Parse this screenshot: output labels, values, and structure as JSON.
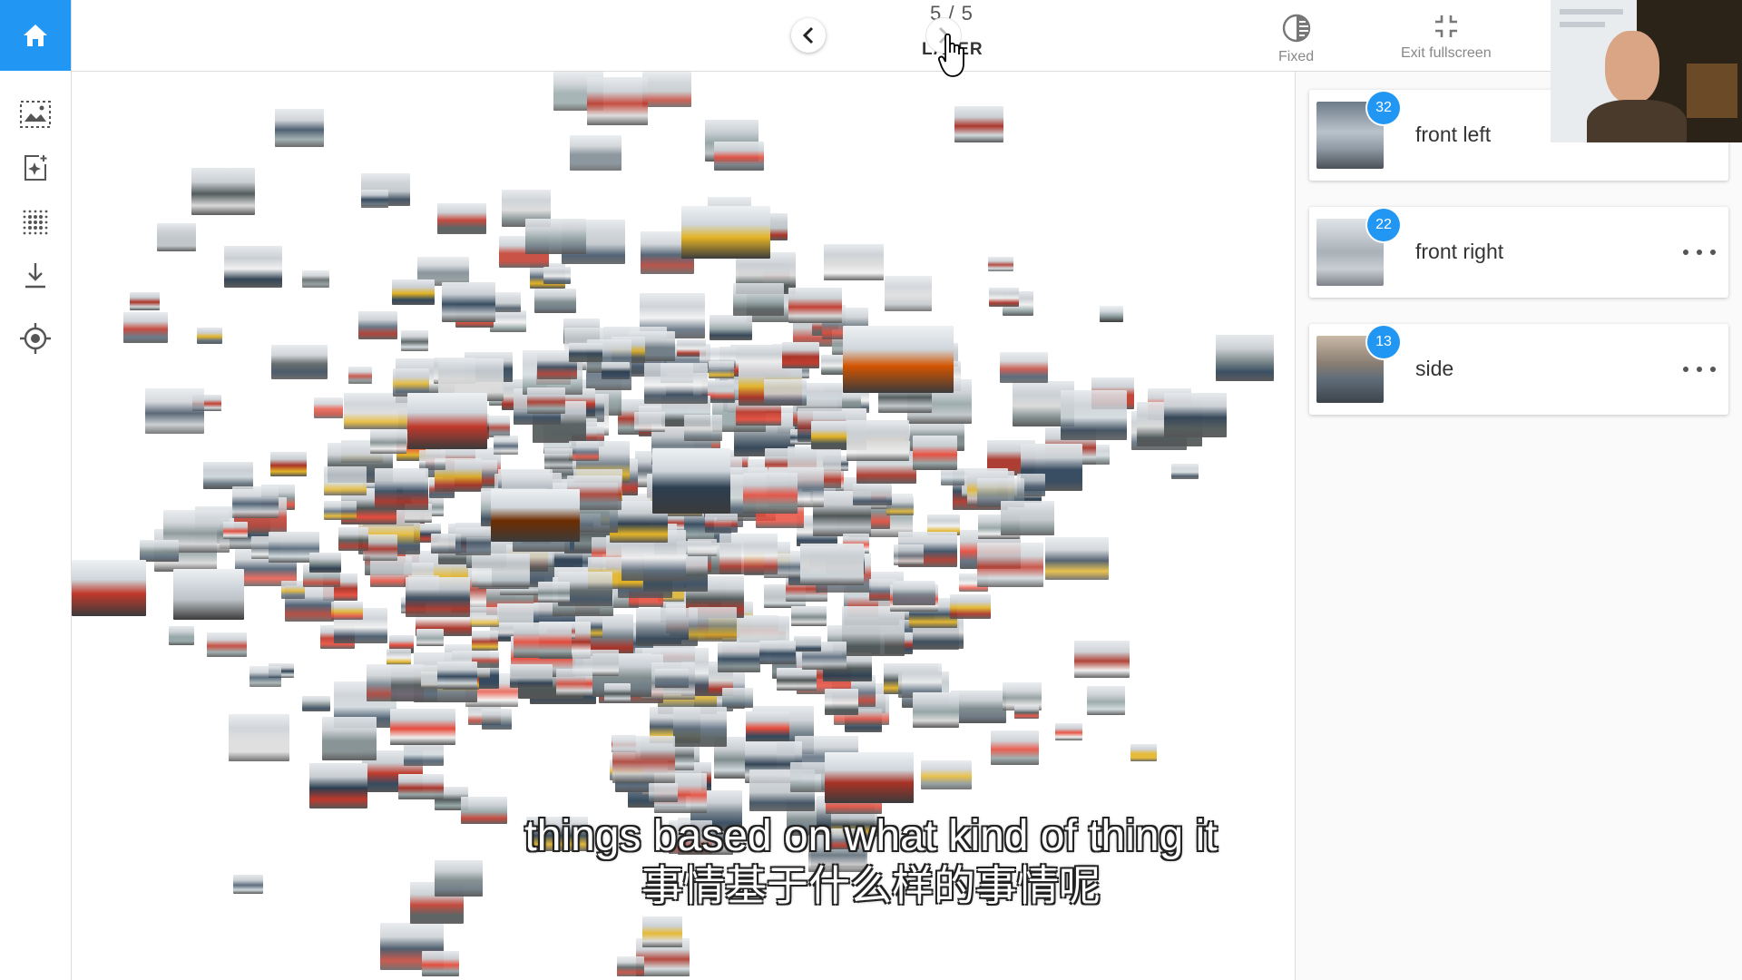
{
  "header": {
    "counter": "5 / 5",
    "layer_label": "LAYER",
    "tools": [
      {
        "label": "Fixed",
        "icon": "contrast-icon"
      },
      {
        "label": "Exit fullscreen",
        "icon": "exit-fullscreen-icon"
      }
    ]
  },
  "sidebar": {
    "items": [
      {
        "name": "home",
        "icon": "home-icon"
      },
      {
        "name": "image-select",
        "icon": "image-selection-icon"
      },
      {
        "name": "add-sparkle",
        "icon": "add-sparkle-icon"
      },
      {
        "name": "grid",
        "icon": "dot-grid-icon"
      },
      {
        "name": "download",
        "icon": "download-icon"
      },
      {
        "name": "locate",
        "icon": "crosshair-icon"
      }
    ]
  },
  "clusters": [
    {
      "count": "32",
      "label": "front left"
    },
    {
      "count": "22",
      "label": "front right"
    },
    {
      "count": "13",
      "label": "side"
    }
  ],
  "subtitles": {
    "en": "things based on what kind of thing it",
    "zh": "事情基于什么样的事情呢"
  },
  "colors": {
    "accent": "#2196f3",
    "border": "#dcdcdc"
  }
}
